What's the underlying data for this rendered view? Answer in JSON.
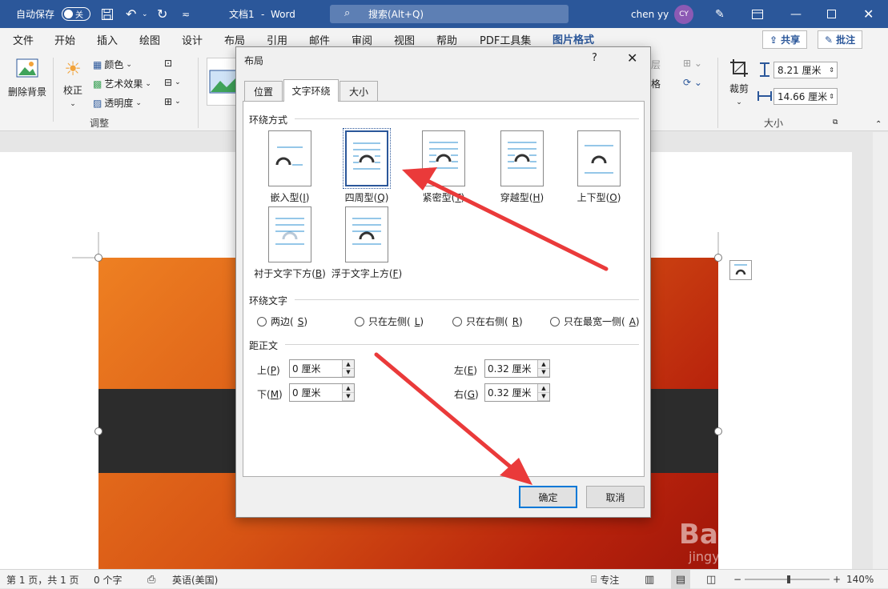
{
  "titlebar": {
    "autosave_label": "自动保存",
    "autosave_state": "关",
    "doc_title": "文档1",
    "app_name": "Word",
    "search_placeholder": "搜索(Alt+Q)",
    "user_name": "chen yy",
    "avatar_initials": "CY"
  },
  "menu": {
    "items": [
      "文件",
      "开始",
      "插入",
      "绘图",
      "设计",
      "布局",
      "引用",
      "邮件",
      "审阅",
      "视图",
      "帮助",
      "PDF工具集",
      "图片格式"
    ],
    "active_index": 12,
    "share_label": "共享",
    "comment_label": "批注"
  },
  "ribbon": {
    "remove_bg": "删除背景",
    "corrections": "校正",
    "color": "颜色",
    "artistic_effects": "艺术效果",
    "transparency": "透明度",
    "adjust_group": "调整",
    "crop": "裁剪",
    "height_value": "8.21 厘米",
    "width_value": "14.66 厘米",
    "size_group": "大小",
    "partial_a": "层",
    "partial_b": "格"
  },
  "dialog": {
    "title": "布局",
    "help": "?",
    "tabs": [
      "位置",
      "文字环绕",
      "大小"
    ],
    "active_tab": 1,
    "wrap_section": "环绕方式",
    "wrap_options": [
      {
        "label": "嵌入型(",
        "key": "I",
        "tail": ")"
      },
      {
        "label": "四周型(",
        "key": "Q",
        "tail": ")"
      },
      {
        "label": "紧密型(",
        "key": "T",
        "tail": ")"
      },
      {
        "label": "穿越型(",
        "key": "H",
        "tail": ")"
      },
      {
        "label": "上下型(",
        "key": "O",
        "tail": ")"
      },
      {
        "label": "衬于文字下方(",
        "key": "B",
        "tail": ")"
      },
      {
        "label": "浮于文字上方(",
        "key": "F",
        "tail": ")"
      }
    ],
    "selected_wrap": 1,
    "wrap_text_section": "环绕文字",
    "wrap_text_options": [
      {
        "label": "两边(",
        "key": "S",
        "tail": ")"
      },
      {
        "label": "只在左侧(",
        "key": "L",
        "tail": ")"
      },
      {
        "label": "只在右侧(",
        "key": "R",
        "tail": ")"
      },
      {
        "label": "只在最宽一侧(",
        "key": "A",
        "tail": ")"
      }
    ],
    "distance_section": "距正文",
    "top_label": "上(",
    "top_key": "P",
    "top_value": "0 厘米",
    "bottom_label": "下(",
    "bottom_key": "M",
    "bottom_value": "0 厘米",
    "left_label": "左(",
    "left_key": "E",
    "left_value": "0.32 厘米",
    "right_label": "右(",
    "right_key": "G",
    "right_value": "0.32 厘米",
    "ok": "确定",
    "cancel": "取消"
  },
  "statusbar": {
    "page": "第 1 页，共 1 页",
    "words": "0 个字",
    "language": "英语(美国)",
    "focus": "专注",
    "zoom": "140%"
  },
  "watermark": {
    "brand": "Bai du 经验",
    "url": "jingyan.baidu.com"
  },
  "colors": {
    "word_blue": "#2b579a",
    "annotation_arrow": "#ea3a3a"
  }
}
